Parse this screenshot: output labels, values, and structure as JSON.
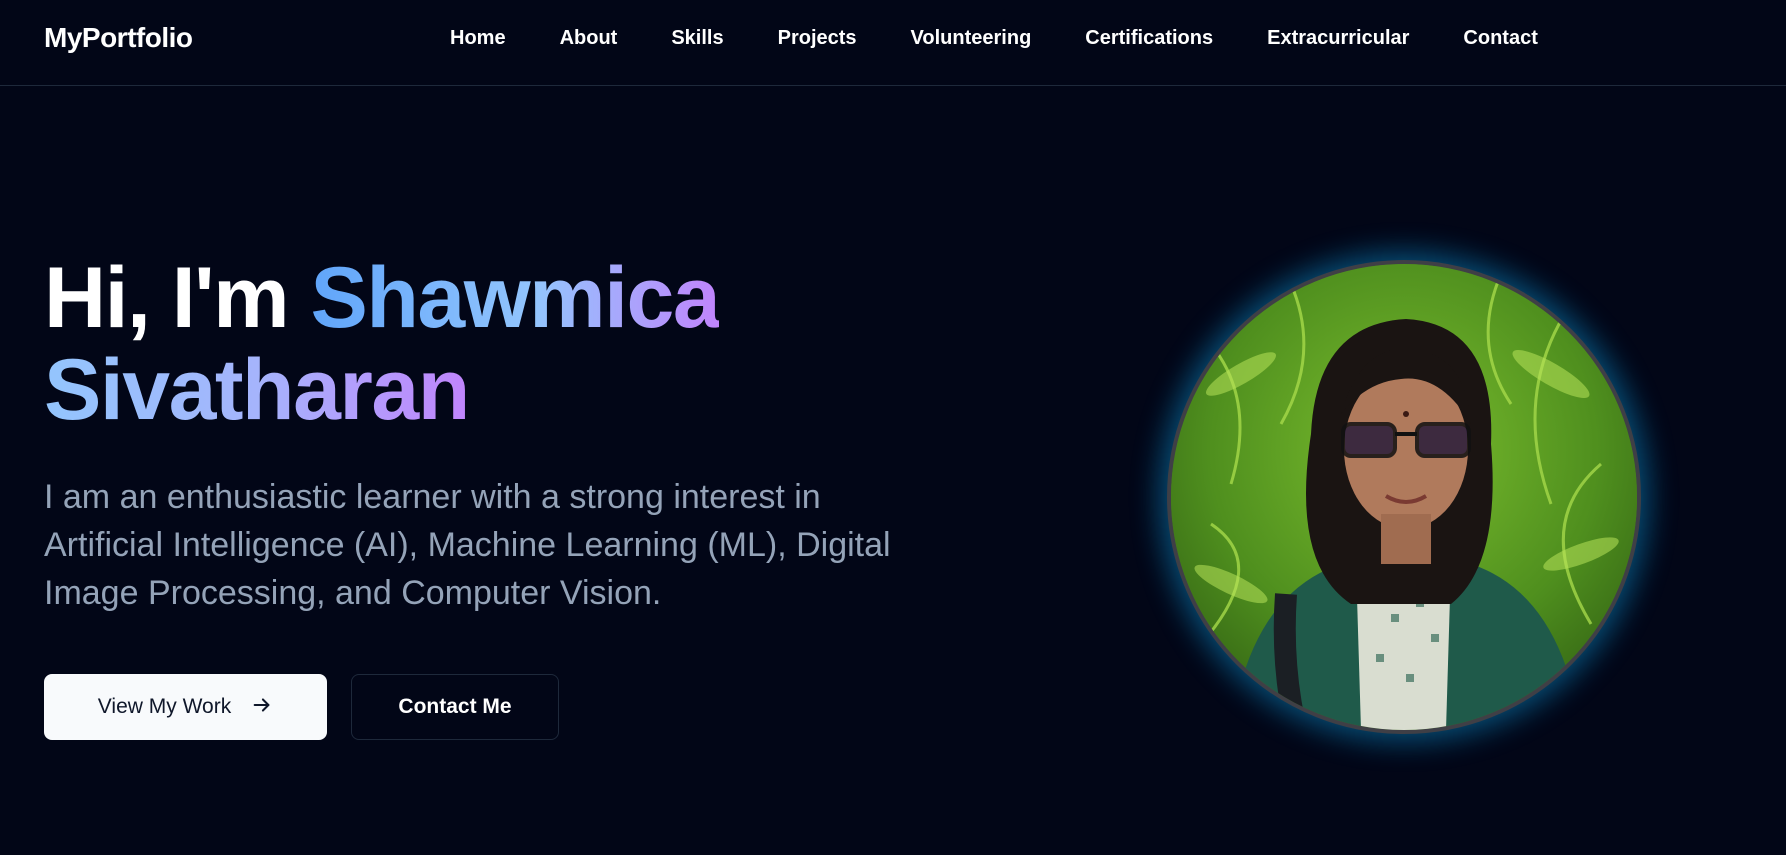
{
  "brand": "MyPortfolio",
  "nav": {
    "items": [
      "Home",
      "About",
      "Skills",
      "Projects",
      "Volunteering",
      "Certifications",
      "Extracurricular",
      "Contact"
    ]
  },
  "hero": {
    "greeting": "Hi, I'm",
    "first_name": "Shawmica",
    "last_name": "Sivatharan",
    "description": "I am an enthusiastic learner with a strong interest in Artificial Intelligence (AI), Machine Learning (ML), Digital Image Processing, and Computer Vision.",
    "primary_button": "View My Work",
    "secondary_button": "Contact Me"
  },
  "colors": {
    "background": "#020617",
    "accent_blue": "#60a5fa",
    "accent_purple": "#c084fc",
    "muted_text": "#94a3b8",
    "glow": "#0ea5e9"
  },
  "icons": {
    "primary_button_icon": "arrow-right-icon"
  }
}
